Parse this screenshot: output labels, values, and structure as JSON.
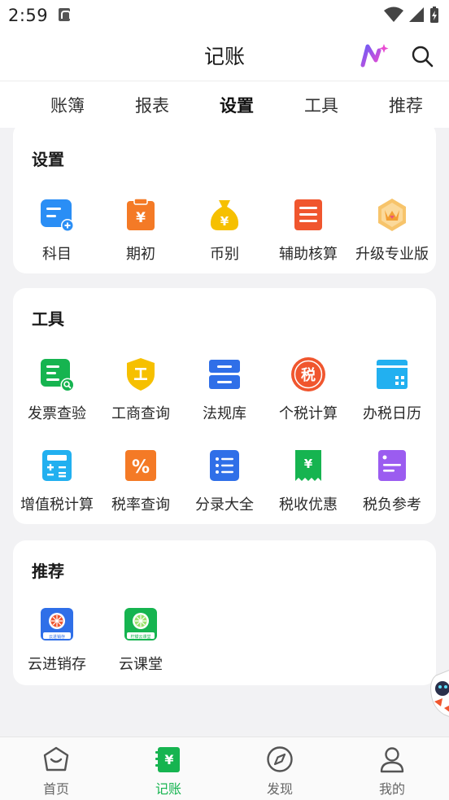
{
  "status_bar": {
    "time": "2:59"
  },
  "header": {
    "title": "记账"
  },
  "tabs": [
    {
      "label": "账簿"
    },
    {
      "label": "报表"
    },
    {
      "label": "设置"
    },
    {
      "label": "工具"
    },
    {
      "label": "推荐"
    }
  ],
  "active_tab": "设置",
  "sections": {
    "settings": {
      "title": "设置",
      "items": [
        {
          "label": "科目",
          "icon": "subject-add-icon"
        },
        {
          "label": "期初",
          "icon": "clipboard-yen-icon"
        },
        {
          "label": "币别",
          "icon": "money-bag-icon"
        },
        {
          "label": "辅助核算",
          "icon": "list-doc-icon"
        },
        {
          "label": "升级专业版",
          "icon": "crown-badge-icon"
        }
      ]
    },
    "tools": {
      "title": "工具",
      "items": [
        {
          "label": "发票查验",
          "icon": "invoice-search-icon"
        },
        {
          "label": "工商查询",
          "icon": "shield-business-icon"
        },
        {
          "label": "法规库",
          "icon": "law-library-icon"
        },
        {
          "label": "个税计算",
          "icon": "tax-stamp-icon"
        },
        {
          "label": "办税日历",
          "icon": "calendar-icon"
        },
        {
          "label": "增值税计算",
          "icon": "calculator-icon"
        },
        {
          "label": "税率查询",
          "icon": "percent-icon"
        },
        {
          "label": "分录大全",
          "icon": "bullet-list-icon"
        },
        {
          "label": "税收优惠",
          "icon": "receipt-yen-icon"
        },
        {
          "label": "税负参考",
          "icon": "document-icon"
        }
      ]
    },
    "recommend": {
      "title": "推荐",
      "items": [
        {
          "label": "云进销存",
          "icon": "cloud-inventory-app-icon",
          "badge_text": "云进销存"
        },
        {
          "label": "云课堂",
          "icon": "cloud-classroom-app-icon",
          "badge_text": "柠檬云课堂"
        }
      ]
    }
  },
  "bottom_nav": [
    {
      "label": "首页",
      "icon": "home-icon"
    },
    {
      "label": "记账",
      "icon": "ledger-yen-icon"
    },
    {
      "label": "发现",
      "icon": "compass-icon"
    },
    {
      "label": "我的",
      "icon": "profile-icon"
    }
  ],
  "active_nav": "记账",
  "colors": {
    "accent_green": "#16b450",
    "blue": "#2a8ef5",
    "orange": "#f47a26",
    "yellow": "#f6c000",
    "red": "#f0562e",
    "purple": "#9b5cf0",
    "page_bg": "#f2f2f4"
  }
}
